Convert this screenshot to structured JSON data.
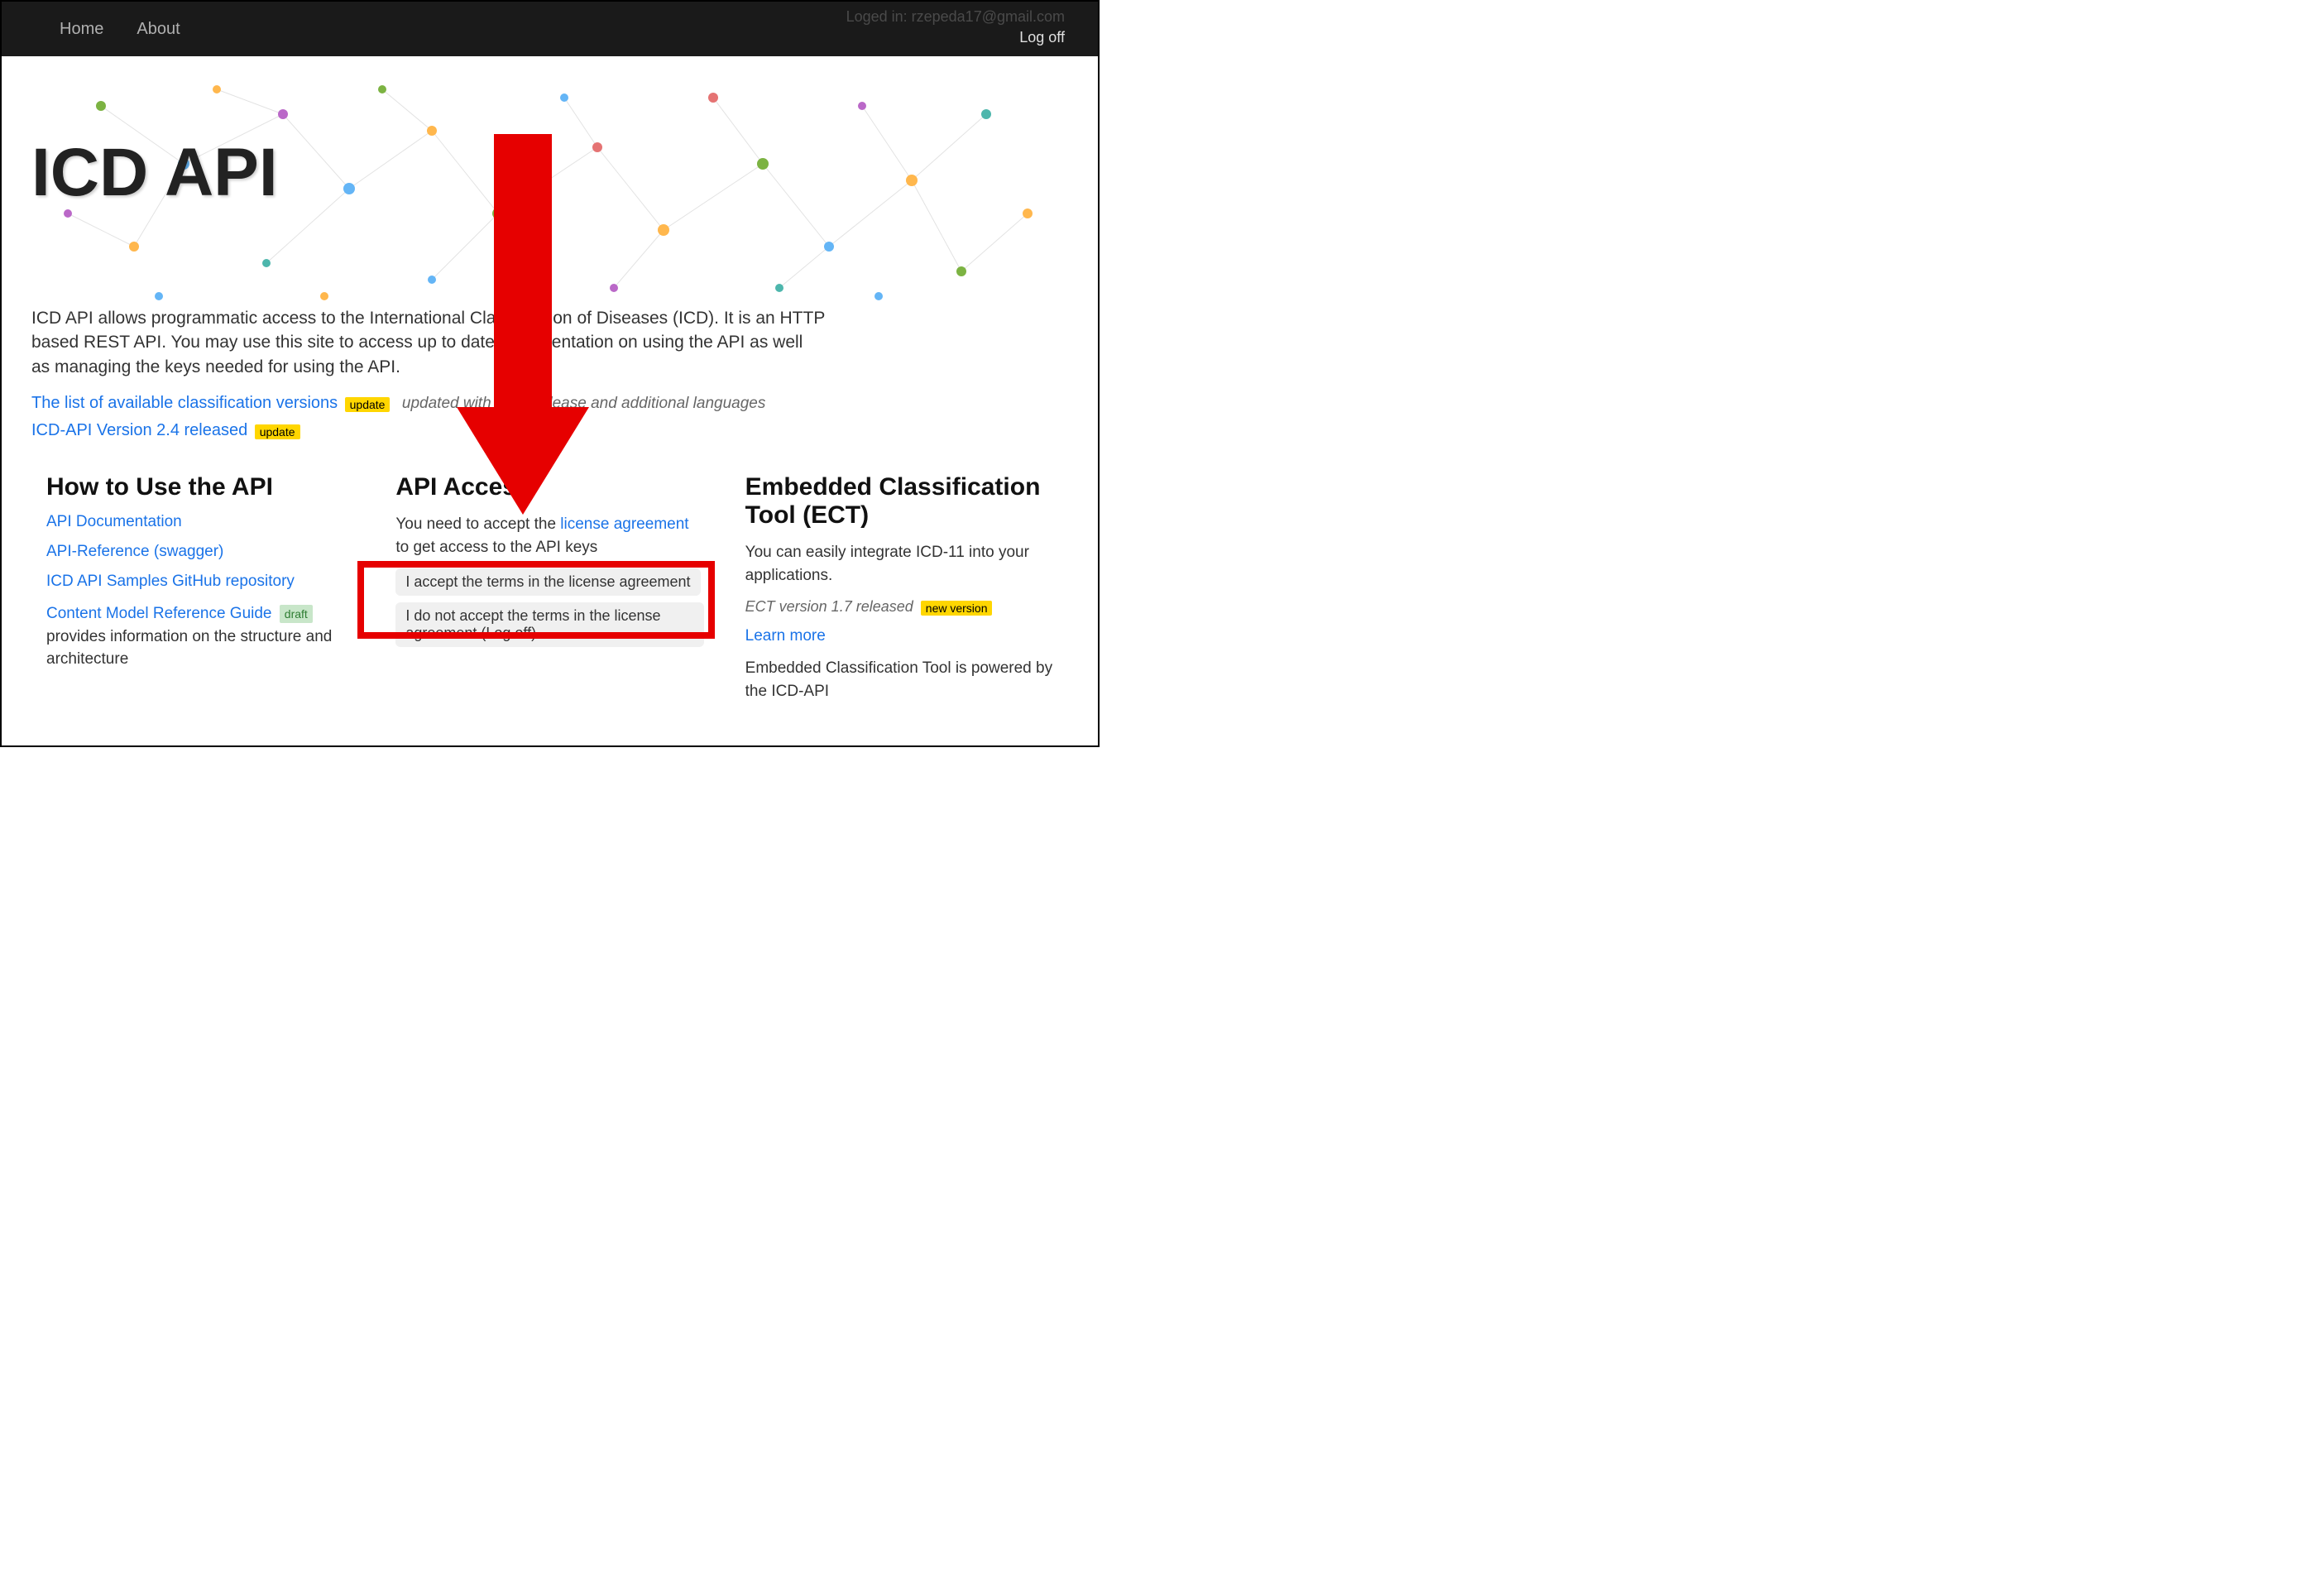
{
  "nav": {
    "home": "Home",
    "about": "About",
    "logged_in": "Loged in: rzepeda17@gmail.com",
    "logoff": "Log off"
  },
  "hero": {
    "title": "ICD API"
  },
  "intro": "ICD API allows programmatic access to the International Classification of Diseases (ICD). It is an HTTP based REST API. You may use this site to access up to date documentation on using the API as well as managing the keys needed for using the API.",
  "updates": {
    "versions_link": "The list of available classification versions",
    "versions_badge": "update",
    "versions_note": "updated with 2024 release and additional languages",
    "v24_link": "ICD-API Version 2.4 released",
    "v24_badge": "update"
  },
  "howto": {
    "heading": "How to Use the API",
    "links": {
      "doc": "API Documentation",
      "ref": "API-Reference (swagger)",
      "samples": "ICD API Samples GitHub repository",
      "model": "Content Model Reference Guide",
      "model_badge": "draft",
      "model_tail": " provides information on the structure and architecture"
    }
  },
  "access": {
    "heading": "API Access",
    "text_pre": "You need to accept the ",
    "license_link": "license agreement",
    "text_post": " to get access to the API keys",
    "accept_btn": "I accept the terms in the license agreement",
    "reject_btn": "I do not accept the terms in the license agreement (Log off)"
  },
  "ect": {
    "heading": "Embedded Classification Tool (ECT)",
    "desc": "You can easily integrate ICD-11 into your applications.",
    "version_text": "ECT version 1.7 released",
    "version_badge": "new version",
    "learn_more": "Learn more",
    "powered": "Embedded Classification Tool is powered by the ICD-API"
  }
}
